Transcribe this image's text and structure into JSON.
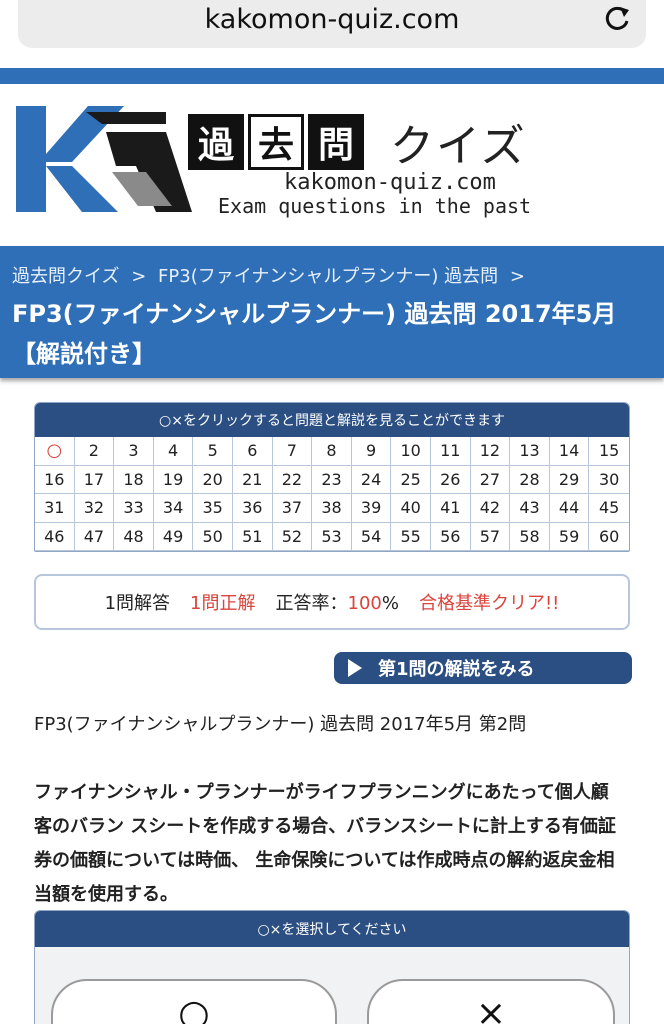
{
  "browser": {
    "url": "kakomon-quiz.com"
  },
  "logo": {
    "kanji": [
      "過",
      "去",
      "問"
    ],
    "kana": "クイズ",
    "domain": "kakomon-quiz.com",
    "tagline": "Exam questions in the past"
  },
  "breadcrumb": [
    "過去問クイズ",
    ">",
    "FP3(ファイナンシャルプランナー) 過去問",
    ">"
  ],
  "page_title": "FP3(ファイナンシャルプランナー) 過去問 2017年5月 【解説付き】",
  "grid": {
    "header": "○×をクリックすると問題と解説を見ることができます",
    "cells": [
      "○",
      "2",
      "3",
      "4",
      "5",
      "6",
      "7",
      "8",
      "9",
      "10",
      "11",
      "12",
      "13",
      "14",
      "15",
      "16",
      "17",
      "18",
      "19",
      "20",
      "21",
      "22",
      "23",
      "24",
      "25",
      "26",
      "27",
      "28",
      "29",
      "30",
      "31",
      "32",
      "33",
      "34",
      "35",
      "36",
      "37",
      "38",
      "39",
      "40",
      "41",
      "42",
      "43",
      "44",
      "45",
      "46",
      "47",
      "48",
      "49",
      "50",
      "51",
      "52",
      "53",
      "54",
      "55",
      "56",
      "57",
      "58",
      "59",
      "60"
    ]
  },
  "score": {
    "answered": "1問解答",
    "correct": "1問正解",
    "rate_label": "正答率：",
    "rate_value": "100",
    "rate_unit": "%",
    "result": "合格基準クリア!!"
  },
  "explain_button": "第1問の解説をみる",
  "question_label": "FP3(ファイナンシャルプランナー) 過去問 2017年5月  第2問",
  "question_text": "ファイナンシャル・プランナーがライフプランニングにあたって個人顧客のバラン スシートを作成する場合、バランスシートに計上する有価証券の価額については時価、 生命保険については作成時点の解約返戻金相当額を使用する。",
  "answer": {
    "header": "○×を選択してください",
    "option_o": "○",
    "option_x": "×"
  },
  "colors": {
    "primary": "#2f6fb7",
    "dark_blue": "#2b4f82",
    "accent_red": "#d9443c"
  }
}
